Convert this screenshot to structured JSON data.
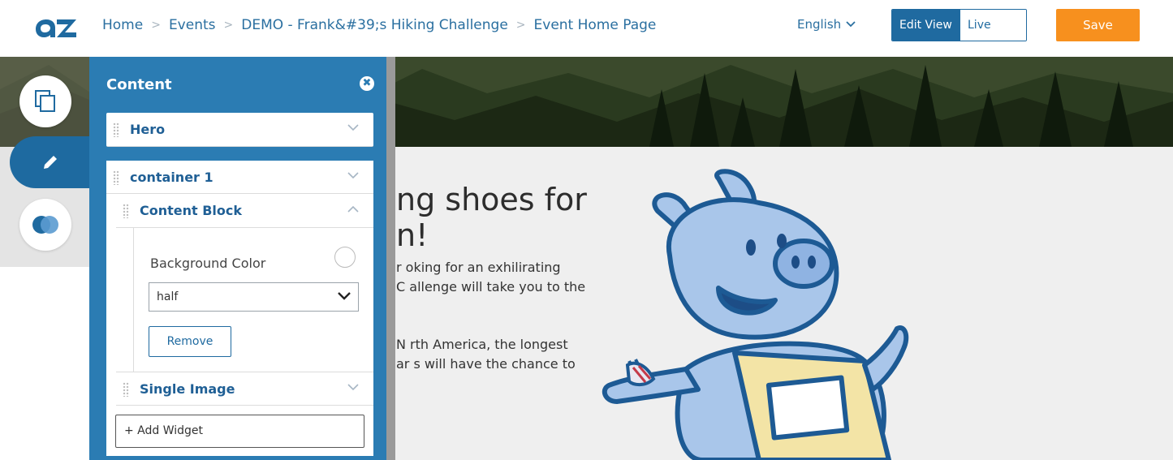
{
  "header": {
    "breadcrumbs": [
      "Home",
      "Events",
      "DEMO - Frank&#39;s Hiking Challenge",
      "Event Home Page"
    ],
    "separator": ">",
    "language": "English",
    "edit_view_label": "Edit View",
    "live_view_label": "Live View",
    "save_label": "Save"
  },
  "page": {
    "headline_line1": "ng shoes for",
    "headline_line2": "n!",
    "para1_line1": "r  oking for an exhilirating",
    "para1_line2": "C  allenge will take you to the",
    "para2_line1": "N  rth America, the longest",
    "para2_line2": "ar  s will have the chance to"
  },
  "panel": {
    "title": "Content",
    "close_glyph": "✖",
    "items": [
      {
        "label": "Hero"
      },
      {
        "label": "container 1"
      },
      {
        "label": "Content Block"
      },
      {
        "label": "Single Image"
      }
    ],
    "background_color_label": "Background Color",
    "select_value": "half",
    "remove_label": "Remove",
    "add_widget_label": "+ Add Widget"
  },
  "colors": {
    "primary": "#1f6aa0",
    "save": "#f7901e",
    "panel": "#2b7cb3"
  }
}
